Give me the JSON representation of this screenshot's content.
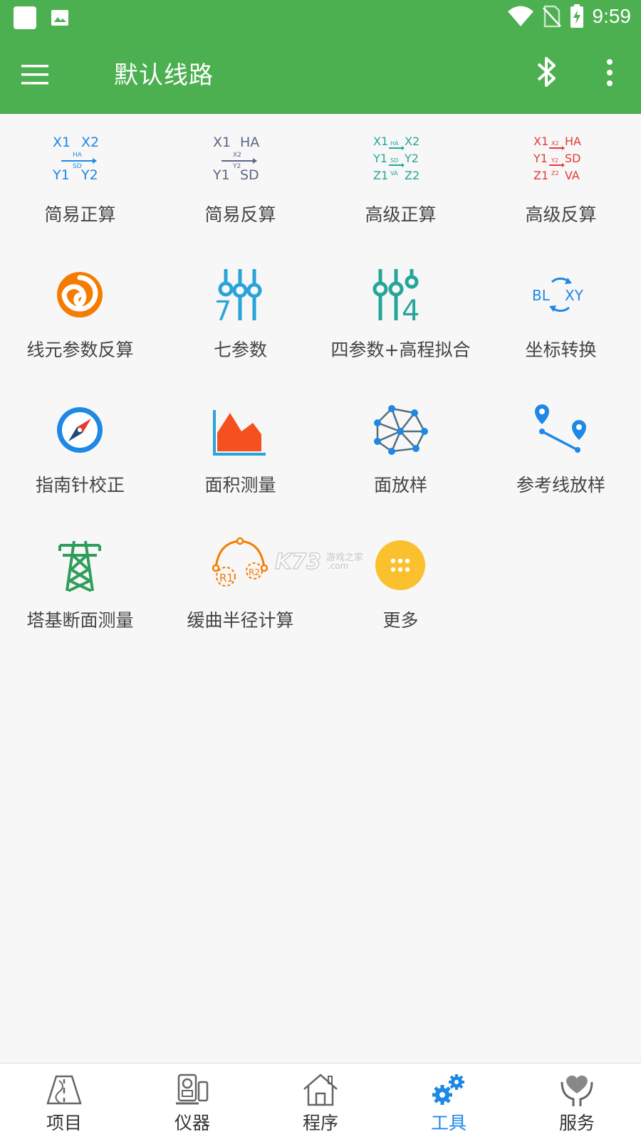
{
  "status": {
    "time": "9:59"
  },
  "app_bar": {
    "title": "默认线路"
  },
  "tools": [
    {
      "label": "简易正算",
      "icon": "simple-forward-calc-icon"
    },
    {
      "label": "简易反算",
      "icon": "simple-inverse-calc-icon"
    },
    {
      "label": "高级正算",
      "icon": "advanced-forward-calc-icon"
    },
    {
      "label": "高级反算",
      "icon": "advanced-inverse-calc-icon"
    },
    {
      "label": "线元参数反算",
      "icon": "swirl-icon"
    },
    {
      "label": "七参数",
      "icon": "seven-param-sliders-icon"
    },
    {
      "label": "四参数+高程拟合",
      "icon": "four-param-sliders-icon"
    },
    {
      "label": "坐标转换",
      "icon": "bl-xy-convert-icon"
    },
    {
      "label": "指南针校正",
      "icon": "compass-icon"
    },
    {
      "label": "面积测量",
      "icon": "area-chart-icon"
    },
    {
      "label": "面放样",
      "icon": "mesh-network-icon"
    },
    {
      "label": "参考线放样",
      "icon": "reference-line-pins-icon"
    },
    {
      "label": "塔基断面测量",
      "icon": "power-tower-icon"
    },
    {
      "label": "缓曲半径计算",
      "icon": "curve-radius-icon"
    },
    {
      "label": "更多",
      "icon": "more-apps-icon"
    }
  ],
  "icon_text": {
    "sf": {
      "a": "X1",
      "b": "X2",
      "c": "HA",
      "d": "SD",
      "e": "Y1",
      "f": "Y2"
    },
    "si": {
      "a": "X1",
      "b": "HA",
      "c": "X2",
      "d": "Y2",
      "e": "Y1",
      "f": "SD"
    },
    "af": {
      "x1": "X1",
      "x2": "X2",
      "y1": "Y1",
      "y2": "Y2",
      "z1": "Z1",
      "z2": "Z2",
      "ha": "HA",
      "sd": "SD",
      "va": "VA"
    },
    "ai": {
      "x1": "X1",
      "ha": "HA",
      "y1": "Y1",
      "sd": "SD",
      "z1": "Z1",
      "va": "VA",
      "x2": "X2",
      "y2": "Y2",
      "z2": "Z2"
    },
    "seven": "7",
    "four": "4",
    "bl": "BL",
    "xy": "XY",
    "r1": "R1",
    "r2": "R2"
  },
  "watermark": {
    "brand": "K73",
    "sub": "游戏之家",
    "dom": ".com"
  },
  "bottom_nav": [
    {
      "label": "项目",
      "icon": "road-icon",
      "active": false
    },
    {
      "label": "仪器",
      "icon": "instrument-icon",
      "active": false
    },
    {
      "label": "程序",
      "icon": "home-icon",
      "active": false
    },
    {
      "label": "工具",
      "icon": "gears-icon",
      "active": true
    },
    {
      "label": "服务",
      "icon": "heart-hand-icon",
      "active": false
    }
  ],
  "colors": {
    "green": "#4caf50",
    "blue": "#1e88e5",
    "teal": "#26a69a",
    "red": "#e53935",
    "orange": "#f57c00",
    "yellow": "#fbc02d"
  }
}
